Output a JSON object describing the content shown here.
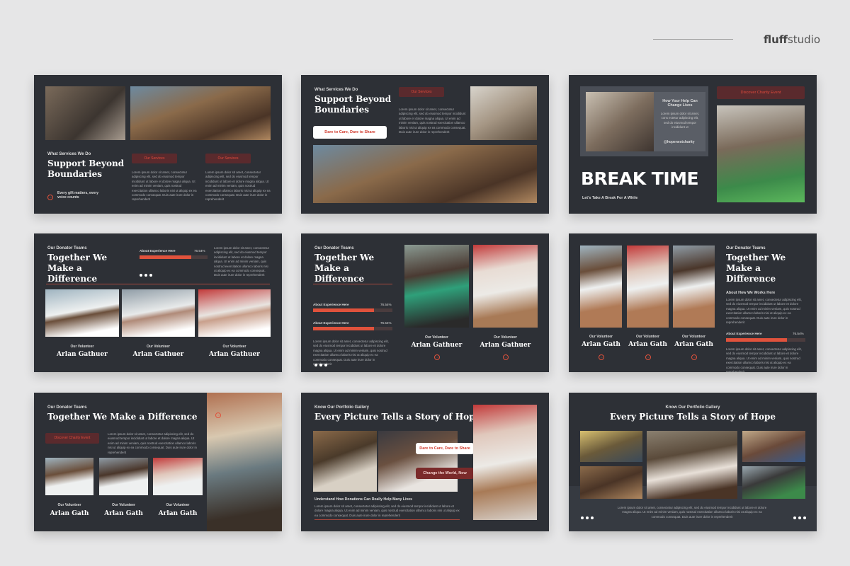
{
  "brand": {
    "name_bold": "fluff",
    "name_rest": "studio"
  },
  "lorem": "Lorem ipsum dolor sit amet, consectetur adipiscing elit, sed do eiusmod tempor incididunt ut labore et dolore magna aliqua. Ut enim ad minim veniam, quis nostrud exercitation ullamco laboris nisi ut aliquip ex ea commodo consequat. Duis aute irure dolor in reprehenderit",
  "slide1": {
    "subtitle": "What Services We Do",
    "title": "Support Beyond Boundaries",
    "tagline": "Every gift matters, every voice counts",
    "pill1": "Our Services",
    "pill2": "Our Services"
  },
  "slide2": {
    "subtitle": "What Services We Do",
    "title": "Support Beyond Boundaries",
    "pill": "Our Services",
    "button": "Dare to Care, Dare to Share"
  },
  "slide3": {
    "card_title": "How Your Help Can Change Lives",
    "card_text": "Lorem ipsum dolor sit amet, cons ectetur adipiscing elit, sed do eiusmod tempor incididunt ut",
    "handle": "@hopenestcharity",
    "pill": "Discover Charity Event",
    "title": "BREAK TIME",
    "subtitle": "Let's Take A Break For A While"
  },
  "slide4": {
    "subtitle": "Our Donator Teams",
    "title": "Together We Make a Difference",
    "bar_label": "About Experience Here",
    "bar_pct": "76.54%",
    "bar_value": 0.7654,
    "vol_label": "Our Volunteer",
    "names": [
      "Arlan Gathuer",
      "Arlan Gathuer",
      "Arlan Gathuer"
    ]
  },
  "slide5": {
    "subtitle": "Our Donator Teams",
    "title": "Together We Make a Difference",
    "bar_label": "About Experience Here",
    "bar_pct": "76.54%",
    "bar_value": 0.7654,
    "vol_label": "Our Volunteer",
    "names": [
      "Arlan Gathuer",
      "Arlan Gathuer"
    ]
  },
  "slide6": {
    "subtitle": "Our Donator Teams",
    "title": "Together We Make a Difference",
    "section": "About How We Works Here",
    "bar_label": "About Experience Here",
    "bar_pct": "76.54%",
    "bar_value": 0.7654,
    "vol_label": "Our Volunteer",
    "names": [
      "Arlan Gath",
      "Arlan Gath",
      "Arlan Gath"
    ]
  },
  "slide7": {
    "subtitle": "Our Donator Teams",
    "title": "Together We Make a Difference",
    "pill": "Discover Charity Event",
    "vol_label": "Our Volunteer",
    "names": [
      "Arlan Gath",
      "Arlan Gath",
      "Arlan Gath"
    ]
  },
  "slide8": {
    "subtitle": "Know Our Portfolio Gallery",
    "title": "Every Picture Tells a Story of Hope",
    "button1": "Dare to Care, Dare to Share",
    "button2": "Change the World, Now",
    "heading": "Understand How Donations Can Really Help Many Lives"
  },
  "slide9": {
    "subtitle": "Know Our Portfolio Gallery",
    "title": "Every Picture Tells a Story of Hope"
  },
  "colors": {
    "slide_bg": "#2d3036",
    "accent": "#e0523c",
    "pill_bg": "#5a2a2d"
  }
}
